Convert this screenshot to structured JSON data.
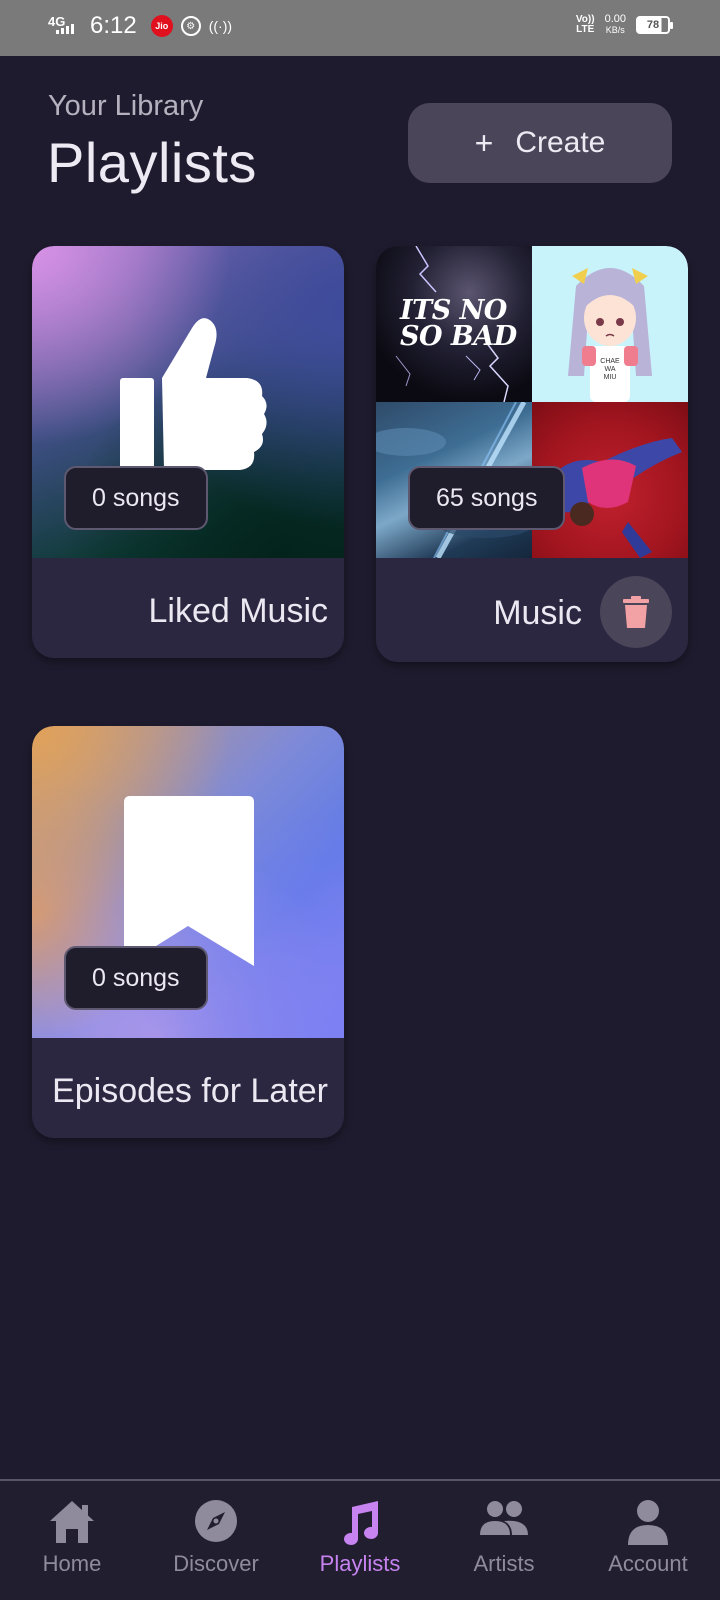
{
  "status_bar": {
    "network": "4G",
    "time": "6:12",
    "carrier_badge": "Jio",
    "lte_label_top": "Vo))",
    "lte_label_bottom": "LTE",
    "speed_value": "0.00",
    "speed_unit": "KB/s",
    "battery": "78"
  },
  "header": {
    "subtitle": "Your Library",
    "title": "Playlists",
    "create_icon": "+",
    "create_label": "Create"
  },
  "playlists": [
    {
      "name": "Liked Music",
      "songs": "0 songs",
      "icon": "thumbs-up-icon"
    },
    {
      "name": "Music",
      "songs": "65 songs",
      "cover_text": [
        "ITS NO",
        "SO BAD"
      ],
      "anime_shirt_text": [
        "CHAE",
        "WA",
        "MIU"
      ]
    },
    {
      "name": "Episodes for Later",
      "songs": "0 songs",
      "icon": "bookmark-icon"
    }
  ],
  "nav": {
    "items": [
      {
        "label": "Home",
        "icon": "home-icon"
      },
      {
        "label": "Discover",
        "icon": "compass-icon"
      },
      {
        "label": "Playlists",
        "icon": "music-note-icon",
        "active": true
      },
      {
        "label": "Artists",
        "icon": "people-icon"
      },
      {
        "label": "Account",
        "icon": "person-icon"
      }
    ]
  },
  "colors": {
    "background": "#1e1b2e",
    "card": "#2b2741",
    "accent": "#c783f0",
    "trash_icon": "#f2a1a5"
  }
}
